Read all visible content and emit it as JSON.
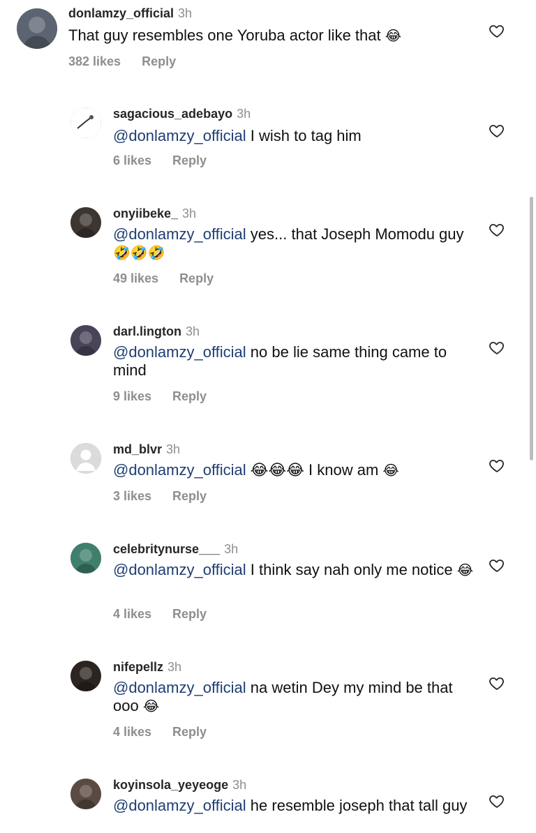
{
  "comments": [
    {
      "username": "donlamzy_official",
      "time": "3h",
      "mention": "",
      "text": "That guy resembles one Yoruba actor like that",
      "emoji": "😂",
      "likes": "382 likes",
      "reply": "Reply",
      "avatar_icon": "person-photo-avatar",
      "avatar_color": "#5b6470"
    },
    {
      "username": "sagacious_adebayo",
      "time": "3h",
      "mention": "@donlamzy_official",
      "text": " I wish to tag him",
      "emoji": "",
      "likes": "6 likes",
      "reply": "Reply",
      "avatar_icon": "sketch-avatar",
      "avatar_color": "#f0f0f0"
    },
    {
      "username": "onyiibeke_",
      "time": "3h",
      "mention": "@donlamzy_official",
      "text": " yes... that Joseph Momodu guy",
      "emoji": "🤣🤣🤣",
      "likes": "49 likes",
      "reply": "Reply",
      "avatar_icon": "photo-avatar",
      "avatar_color": "#3d3530"
    },
    {
      "username": "darl.lington",
      "time": "3h",
      "mention": "@donlamzy_official",
      "text": " no be lie same thing came to mind",
      "emoji": "",
      "likes": "9 likes",
      "reply": "Reply",
      "avatar_icon": "photo-avatar",
      "avatar_color": "#4a4458"
    },
    {
      "username": "md_blvr",
      "time": "3h",
      "mention": "@donlamzy_official",
      "text": " 😂😂😂 I know am",
      "emoji": "😂",
      "likes": "3 likes",
      "reply": "Reply",
      "avatar_icon": "default-user-avatar",
      "avatar_color": "#d8d8d8"
    },
    {
      "username": "celebritynurse___",
      "time": "3h",
      "mention": "@donlamzy_official",
      "text": " I think say nah only me notice",
      "emoji": "😂",
      "likes": "4 likes",
      "reply": "Reply",
      "avatar_icon": "photo-avatar",
      "avatar_color": "#3f7f6e"
    },
    {
      "username": "nifepellz",
      "time": "3h",
      "mention": "@donlamzy_official",
      "text": " na wetin Dey my mind be that ooo",
      "emoji": "😂",
      "likes": "4 likes",
      "reply": "Reply",
      "avatar_icon": "photo-avatar",
      "avatar_color": "#2c2420"
    },
    {
      "username": "koyinsola_yeyeoge",
      "time": "3h",
      "mention": "@donlamzy_official",
      "text": " he resemble joseph that tall guy",
      "emoji": "",
      "likes": "",
      "reply": "",
      "avatar_icon": "photo-avatar",
      "avatar_color": "#5a4a42"
    }
  ],
  "icons": {
    "like": "heart-outline-icon"
  },
  "colors": {
    "mention": "#1e3e73",
    "muted": "#8e8e8e"
  }
}
